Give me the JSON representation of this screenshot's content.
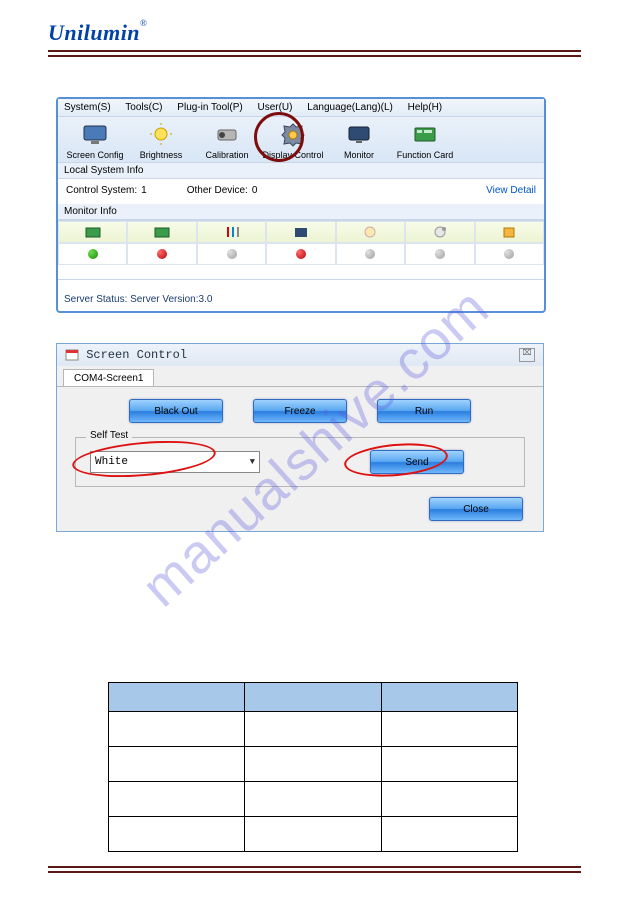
{
  "brand": "Unilumin",
  "brand_symbol": "®",
  "watermark": "manualshive.com",
  "win1": {
    "menu": [
      "System(S)",
      "Tools(C)",
      "Plug-in Tool(P)",
      "User(U)",
      "Language(Lang)(L)",
      "Help(H)"
    ],
    "toolbar": [
      "Screen Config",
      "Brightness",
      "Calibration",
      "Display Control",
      "Monitor",
      "Function Card"
    ],
    "local_label": "Local System Info",
    "control_system_label": "Control System:",
    "control_system_value": "1",
    "other_device_label": "Other Device:",
    "other_device_value": "0",
    "view_detail": "View Detail",
    "monitor_label": "Monitor Info",
    "status": "Server Status:  Server Version:3.0",
    "dots": [
      "green",
      "red",
      "gray",
      "red",
      "gray",
      "gray",
      "gray"
    ]
  },
  "win2": {
    "title": "Screen Control",
    "close_glyph": "⌧",
    "tab": "COM4-Screen1",
    "btn_blackout": "Black Out",
    "btn_freeze": "Freeze",
    "btn_run": "Run",
    "self_test": "Self Test",
    "select_value": "White",
    "btn_send": "Send",
    "btn_close": "Close"
  }
}
